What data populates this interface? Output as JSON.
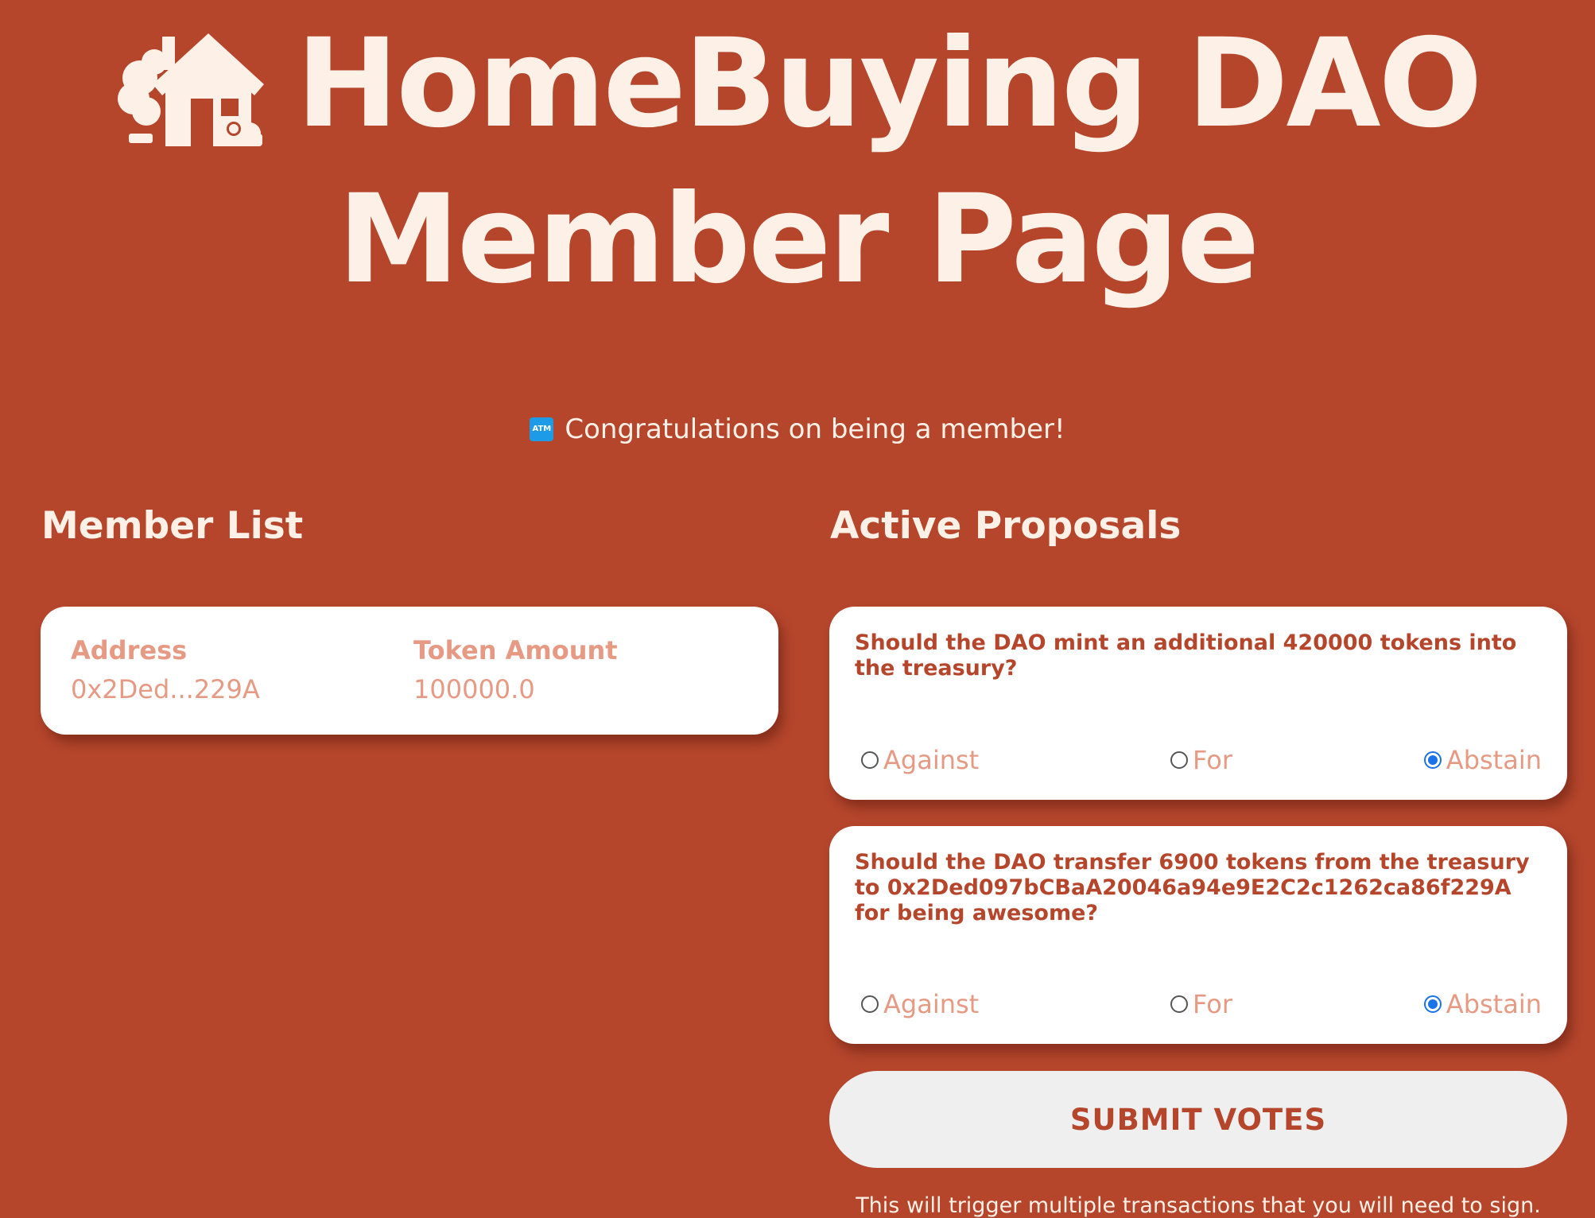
{
  "header": {
    "title_line1": "HomeBuying DAO",
    "title_line2": "Member Page",
    "icon": "house-with-tree-icon"
  },
  "congrats": {
    "icon": "atm-icon",
    "icon_text": "ATM",
    "text": "Congratulations on being a member!"
  },
  "member_list": {
    "title": "Member List",
    "columns": [
      "Address",
      "Token Amount"
    ],
    "rows": [
      {
        "address": "0x2Ded...229A",
        "token_amount": "100000.0"
      }
    ]
  },
  "proposals": {
    "title": "Active Proposals",
    "items": [
      {
        "text": "Should the DAO mint an additional 420000 tokens into the treasury?",
        "options": [
          "Against",
          "For",
          "Abstain"
        ],
        "selected": "Abstain"
      },
      {
        "text": "Should the DAO transfer 6900 tokens from the treasury to 0x2Ded097bCBaA20046a94e9E2C2c1262ca86f229A for being awesome?",
        "options": [
          "Against",
          "For",
          "Abstain"
        ],
        "selected": "Abstain"
      }
    ],
    "submit_label": "SUBMIT VOTES",
    "footnote": "This will trigger multiple transactions that you will need to sign."
  },
  "colors": {
    "background": "#b5462c",
    "text_light": "#fdf0e6",
    "muted_text": "#e69a84",
    "card": "#ffffff",
    "button": "#efefef",
    "radio_selected": "#1a73e8"
  }
}
